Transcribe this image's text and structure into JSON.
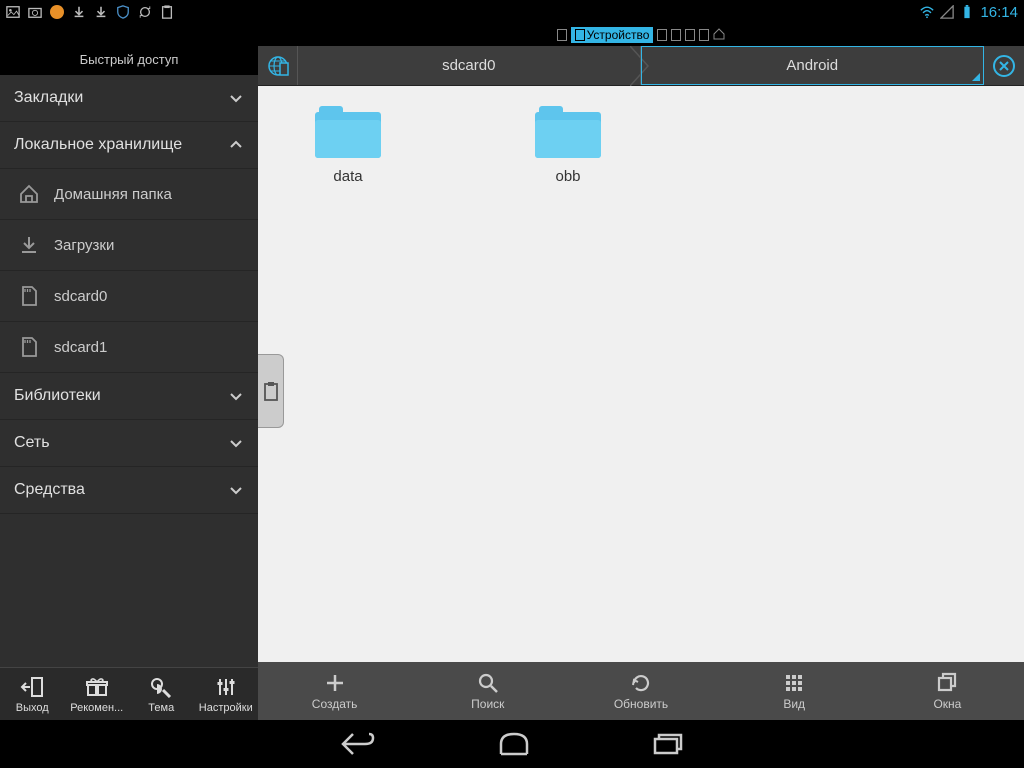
{
  "status": {
    "time": "16:14"
  },
  "tabs": {
    "active_label": "Устройство"
  },
  "sidebar": {
    "title": "Быстрый доступ",
    "sections": {
      "bookmarks": "Закладки",
      "local": "Локальное хранилище",
      "libraries": "Библиотеки",
      "network": "Сеть",
      "tools": "Средства"
    },
    "local_items": {
      "home": "Домашняя папка",
      "downloads": "Загрузки",
      "sd0": "sdcard0",
      "sd1": "sdcard1"
    },
    "bottom": {
      "exit": "Выход",
      "recommend": "Рекомен...",
      "theme": "Тема",
      "settings": "Настройки"
    }
  },
  "path": {
    "seg1": "sdcard0",
    "seg2": "Android"
  },
  "folders": [
    {
      "name": "data"
    },
    {
      "name": "obb"
    }
  ],
  "toolbar": {
    "create": "Создать",
    "search": "Поиск",
    "refresh": "Обновить",
    "view": "Вид",
    "windows": "Окна"
  }
}
